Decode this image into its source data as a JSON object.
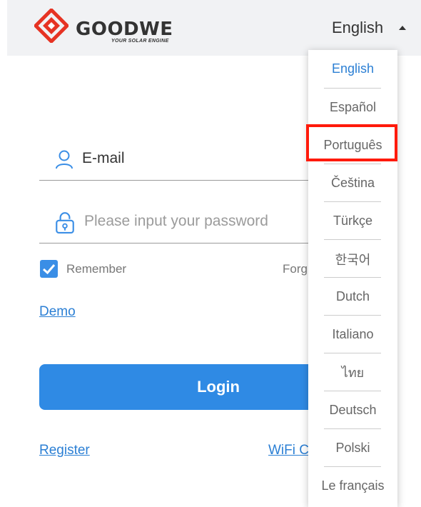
{
  "brand": {
    "name": "GOODWE",
    "tagline": "YOUR SOLAR ENGINE",
    "logo_icon": "goodwe-diamond-logo",
    "accent_color": "#e63323"
  },
  "header": {
    "language_label": "English",
    "caret_icon": "caret-up-icon"
  },
  "login_form": {
    "email_label": "E-mail",
    "email_icon": "user-icon",
    "password_placeholder": "Please input your password",
    "password_icon": "lock-icon",
    "remember_label": "Remember",
    "remember_checked": true,
    "forgot_label": "Forg",
    "demo_label": "Demo",
    "login_label": "Login",
    "register_label": "Register",
    "wifi_label": "WiFi C"
  },
  "language_menu": {
    "selected": "English",
    "highlighted": "Português",
    "items": [
      {
        "label": "English"
      },
      {
        "label": "Español"
      },
      {
        "label": "Português"
      },
      {
        "label": "Čeština"
      },
      {
        "label": "Türkçe"
      },
      {
        "label": "한국어"
      },
      {
        "label": "Dutch"
      },
      {
        "label": "Italiano"
      },
      {
        "label": "ไทย"
      },
      {
        "label": "Deutsch"
      },
      {
        "label": "Polski"
      },
      {
        "label": "Le français"
      }
    ]
  },
  "colors": {
    "primary": "#2f8ae4",
    "link": "#2b7fd4",
    "highlight": "#ff1a0a"
  }
}
